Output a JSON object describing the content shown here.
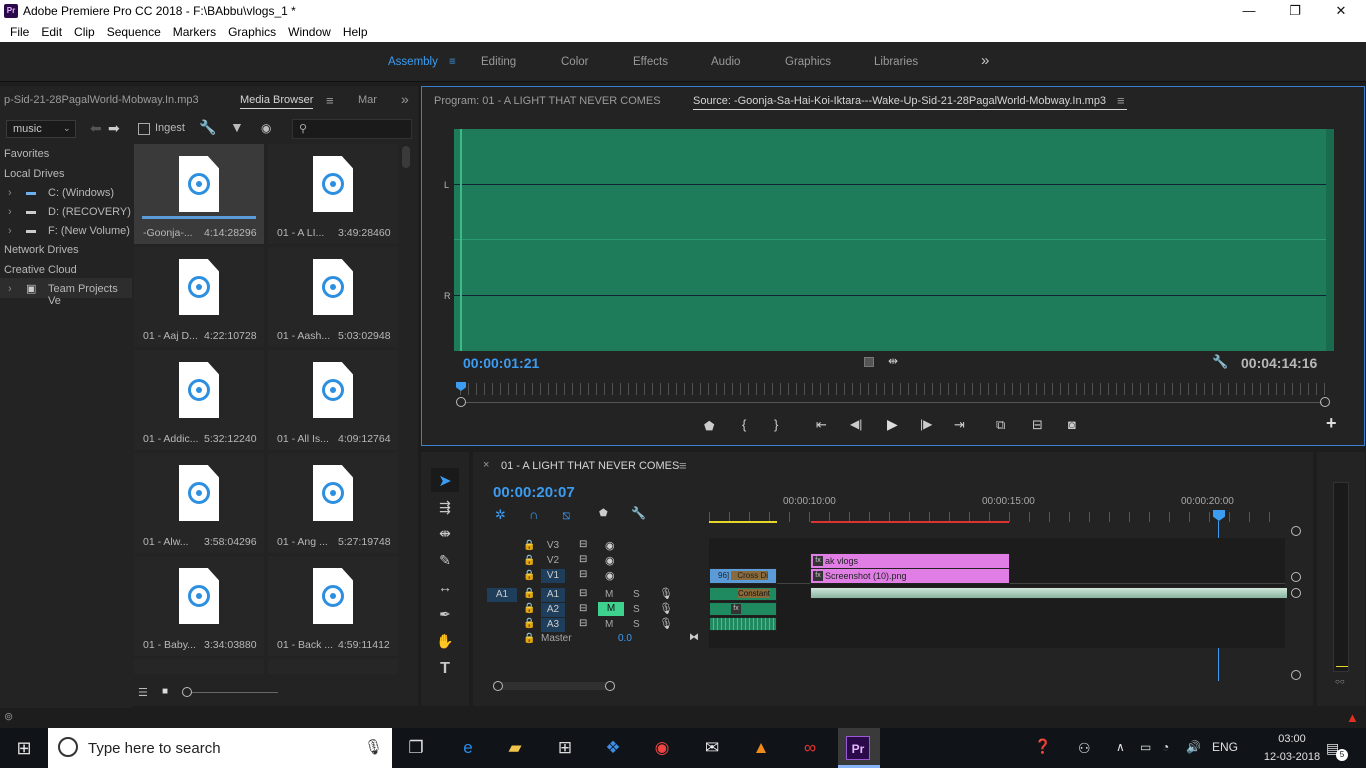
{
  "window": {
    "title": "Adobe Premiere Pro CC 2018 - F:\\BAbbu\\vlogs_1 *",
    "logo": "Pr",
    "min": "—",
    "max": "❐",
    "close": "✕"
  },
  "menu": [
    "File",
    "Edit",
    "Clip",
    "Sequence",
    "Markers",
    "Graphics",
    "Window",
    "Help"
  ],
  "workspaces": {
    "items": [
      "Assembly",
      "Editing",
      "Color",
      "Effects",
      "Audio",
      "Graphics",
      "Libraries"
    ],
    "active": "Assembly",
    "more": "»",
    "menu_icon": "≡"
  },
  "project_panel": {
    "tab_file": "p-Sid-21-28PagalWorld-Mobway.In.mp3",
    "tab_media": "Media Browser",
    "tab_markers": "Mar",
    "overflow": "»",
    "folder": "music",
    "ingest": "Ingest",
    "tree": [
      {
        "label": "Favorites",
        "indent": 0
      },
      {
        "label": "Local Drives",
        "indent": 0
      },
      {
        "label": "C: (Windows)",
        "indent": 1
      },
      {
        "label": "D: (RECOVERY)",
        "indent": 1
      },
      {
        "label": "F: (New Volume)",
        "indent": 1
      },
      {
        "label": "Network Drives",
        "indent": 0
      },
      {
        "label": "Creative Cloud",
        "indent": 0
      },
      {
        "label": "Team Projects Ve",
        "indent": 1
      }
    ],
    "files": [
      {
        "name": "-Goonja-...",
        "dur": "4:14:28296",
        "selected": true
      },
      {
        "name": "01 - A LI...",
        "dur": "3:49:28460",
        "selected": false
      },
      {
        "name": "01 - Aaj D...",
        "dur": "4:22:10728",
        "selected": false
      },
      {
        "name": "01 - Aash...",
        "dur": "5:03:02948",
        "selected": false
      },
      {
        "name": "01 - Addic...",
        "dur": "5:32:12240",
        "selected": false
      },
      {
        "name": "01 - All Is...",
        "dur": "4:09:12764",
        "selected": false
      },
      {
        "name": "01 - Alw...",
        "dur": "3:58:04296",
        "selected": false
      },
      {
        "name": "01 - Ang ...",
        "dur": "5:27:19748",
        "selected": false
      },
      {
        "name": "01 - Baby...",
        "dur": "3:34:03880",
        "selected": false
      },
      {
        "name": "01 - Back ...",
        "dur": "4:59:11412",
        "selected": false
      }
    ]
  },
  "source_monitor": {
    "program_tab": "Program: 01 - A LIGHT THAT NEVER COMES",
    "source_tab": "Source: -Goonja-Sa-Hai-Koi-Iktara---Wake-Up-Sid-21-28PagalWorld-Mobway.In.mp3",
    "menu_icon": "≡",
    "ch_L": "L",
    "ch_R": "R",
    "timecode": "00:00:01:21",
    "duration": "00:04:14:16",
    "playhead_fraction": 0.0,
    "plus": "+"
  },
  "timeline": {
    "tab": "01 - A LIGHT THAT NEVER COMES",
    "close": "×",
    "menu_icon": "≡",
    "timecode": "00:00:20:07",
    "ruler": [
      "00:00:10:00",
      "00:00:15:00",
      "00:00:20:00"
    ],
    "tracks_video": [
      "V3",
      "V2",
      "V1"
    ],
    "tracks_audio": [
      "A1",
      "A2",
      "A3"
    ],
    "src_patch": "A1",
    "master": "Master",
    "master_val": "0.0",
    "m": "M",
    "s": "S",
    "clips": {
      "v3": "ak vlogs",
      "v2": "Screenshot (10).png",
      "v1_trans": "Cross Di",
      "a1": "Constant",
      "fx": "fx",
      "v1_small": "96]"
    }
  },
  "taskbar": {
    "search_placeholder": "Type here to search",
    "lang": "ENG",
    "time": "03:00",
    "date": "12-03-2018",
    "notif": "5"
  },
  "colors": {
    "accent": "#3b9cf2",
    "waveform": "#1f7c5b",
    "clip_pink": "#e07ee6",
    "clip_blue": "#5b9cd8",
    "audio_clip": "#1f8a5f",
    "ruler_red": "#d33",
    "ruler_yellow": "#e6d62a"
  }
}
